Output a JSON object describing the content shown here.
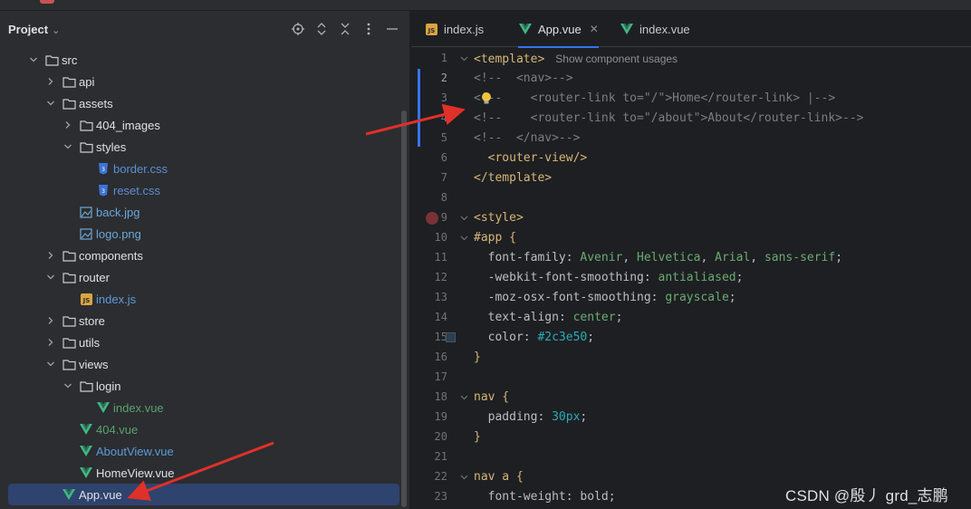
{
  "project": {
    "title": "Project",
    "tools": [
      "locate-icon",
      "expand-icon",
      "collapse-icon",
      "more-icon",
      "hide-icon"
    ]
  },
  "tree": [
    {
      "label": "src",
      "type": "folder",
      "depth": 0,
      "expanded": true
    },
    {
      "label": "api",
      "type": "folder",
      "depth": 1,
      "expanded": false
    },
    {
      "label": "assets",
      "type": "folder",
      "depth": 1,
      "expanded": true
    },
    {
      "label": "404_images",
      "type": "folder",
      "depth": 2,
      "expanded": false
    },
    {
      "label": "styles",
      "type": "folder",
      "depth": 2,
      "expanded": true
    },
    {
      "label": "border.css",
      "type": "css",
      "depth": 3
    },
    {
      "label": "reset.css",
      "type": "css",
      "depth": 3
    },
    {
      "label": "back.jpg",
      "type": "image",
      "depth": 2
    },
    {
      "label": "logo.png",
      "type": "image",
      "depth": 2
    },
    {
      "label": "components",
      "type": "folder",
      "depth": 1,
      "expanded": false
    },
    {
      "label": "router",
      "type": "folder",
      "depth": 1,
      "expanded": true
    },
    {
      "label": "index.js",
      "type": "js",
      "depth": 2
    },
    {
      "label": "store",
      "type": "folder",
      "depth": 1,
      "expanded": false
    },
    {
      "label": "utils",
      "type": "folder",
      "depth": 1,
      "expanded": false
    },
    {
      "label": "views",
      "type": "folder",
      "depth": 1,
      "expanded": true
    },
    {
      "label": "login",
      "type": "folder",
      "depth": 2,
      "expanded": true
    },
    {
      "label": "index.vue",
      "type": "vue-green",
      "depth": 3
    },
    {
      "label": "404.vue",
      "type": "vue-green",
      "depth": 2
    },
    {
      "label": "AboutView.vue",
      "type": "vue-blue",
      "depth": 2
    },
    {
      "label": "HomeView.vue",
      "type": "vue-plain",
      "depth": 2
    },
    {
      "label": "App.vue",
      "type": "vue-plain",
      "depth": 1,
      "selected": true
    }
  ],
  "tabs": [
    {
      "label": "index.js",
      "icon": "js-file-icon",
      "active": false
    },
    {
      "label": "App.vue",
      "icon": "vue-file-icon",
      "active": true,
      "closable": true
    },
    {
      "label": "index.vue",
      "icon": "vue-file-icon",
      "active": false
    }
  ],
  "editor": {
    "hint": "Show component usages",
    "lines": [
      {
        "n": "1",
        "text": "<template>"
      },
      {
        "n": "2",
        "text": "<!--  <nav>-->"
      },
      {
        "n": "3",
        "text": "<!--    <router-link to=\"/\">Home</router-link> |-->"
      },
      {
        "n": "4",
        "text": "<!--    <router-link to=\"/about\">About</router-link>-->"
      },
      {
        "n": "5",
        "text": "<!--  </nav>-->"
      },
      {
        "n": "6",
        "text": "  <router-view/>"
      },
      {
        "n": "7",
        "text": "</template>"
      },
      {
        "n": "8",
        "text": ""
      },
      {
        "n": "9",
        "text": "<style>"
      },
      {
        "n": "10",
        "text": "#app {"
      },
      {
        "n": "11",
        "text": "  font-family: Avenir, Helvetica, Arial, sans-serif;"
      },
      {
        "n": "12",
        "text": "  -webkit-font-smoothing: antialiased;"
      },
      {
        "n": "13",
        "text": "  -moz-osx-font-smoothing: grayscale;"
      },
      {
        "n": "14",
        "text": "  text-align: center;"
      },
      {
        "n": "15",
        "text": "  color: #2c3e50;"
      },
      {
        "n": "16",
        "text": "}"
      },
      {
        "n": "17",
        "text": ""
      },
      {
        "n": "18",
        "text": "nav {"
      },
      {
        "n": "19",
        "text": "  padding: 30px;"
      },
      {
        "n": "20",
        "text": "}"
      },
      {
        "n": "21",
        "text": ""
      },
      {
        "n": "22",
        "text": "nav a {"
      },
      {
        "n": "23",
        "text": "  font-weight: bold;"
      }
    ]
  },
  "watermark": "CSDN @殷丿 grd_志鹏",
  "colors": {
    "selection": "#214283",
    "tree_selected": "#2e436e",
    "arrow": "#e0302a",
    "tab_underline": "#3574f0",
    "swatch": "#2c3e50"
  }
}
